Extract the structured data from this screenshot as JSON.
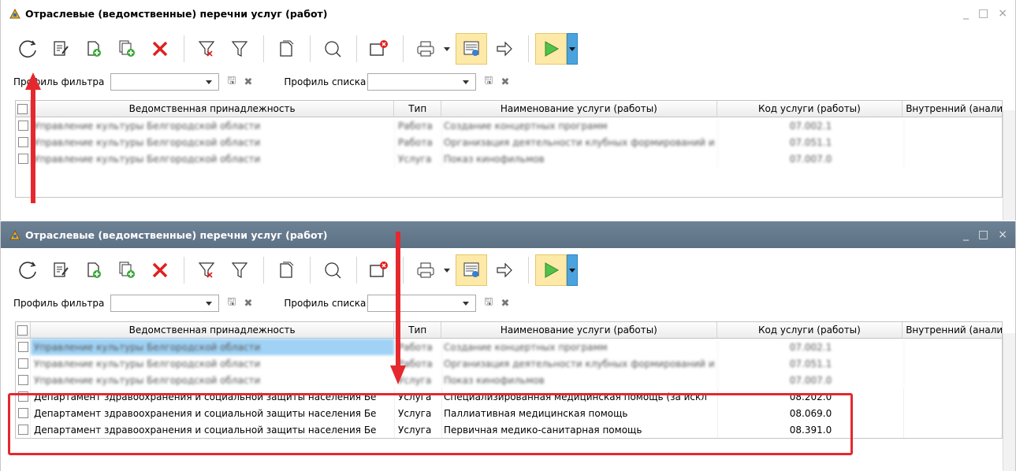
{
  "windows": [
    {
      "title": "Отраслевые (ведомственные) перечни услуг (работ)",
      "filter_profile_label": "Профиль фильтра",
      "list_profile_label": "Профиль списка",
      "columns": [
        "Ведомственная принадлежность",
        "Тип",
        "Наименование услуги (работы)",
        "Код услуги (работы)",
        "Внутренний (аналитичес"
      ],
      "rows": [
        {
          "dept": "Управление культуры Белгородской области",
          "type": "Работа",
          "name": "Создание концертных программ",
          "code": "07.002.1"
        },
        {
          "dept": "Управление культуры Белгородской области",
          "type": "Работа",
          "name": "Организация деятельности клубных формирований и",
          "code": "07.051.1"
        },
        {
          "dept": "Управление культуры Белгородской области",
          "type": "Услуга",
          "name": "Показ кинофильмов",
          "code": "07.007.0"
        }
      ]
    },
    {
      "title": "Отраслевые (ведомственные) перечни услуг (работ)",
      "filter_profile_label": "Профиль фильтра",
      "list_profile_label": "Профиль списка",
      "columns": [
        "Ведомственная принадлежность",
        "Тип",
        "Наименование услуги (работы)",
        "Код услуги (работы)",
        "Внутренний (аналитичес"
      ],
      "rows": [
        {
          "dept": "Управление культуры Белгородской области",
          "type": "Работа",
          "name": "Создание концертных программ",
          "code": "07.002.1"
        },
        {
          "dept": "Управление культуры Белгородской области",
          "type": "Работа",
          "name": "Организация деятельности клубных формирований и",
          "code": "07.051.1"
        },
        {
          "dept": "Управление культуры Белгородской области",
          "type": "Услуга",
          "name": "Показ кинофильмов",
          "code": "07.007.0"
        },
        {
          "dept": "Департамент здравоохранения и социальной защиты населения Бе",
          "type": "Услуга",
          "name": "Специализированная медицинская помощь (за искл",
          "code": "08.202.0"
        },
        {
          "dept": "Департамент здравоохранения и социальной защиты населения Бе",
          "type": "Услуга",
          "name": "Паллиативная медицинская помощь",
          "code": "08.069.0"
        },
        {
          "dept": "Департамент здравоохранения и социальной защиты населения Бе",
          "type": "Услуга",
          "name": "Первичная медико-санитарная помощь",
          "code": "08.391.0"
        }
      ]
    }
  ],
  "window_controls": {
    "minimize": "_",
    "maximize": "□",
    "close": "×"
  },
  "icons": {
    "save": "🖫",
    "clear": "✖",
    "sort_up": "▲"
  },
  "colors": {
    "annotation_red": "#e5282e",
    "selection": "#9fd2f5",
    "active_title": "#5d7185"
  }
}
